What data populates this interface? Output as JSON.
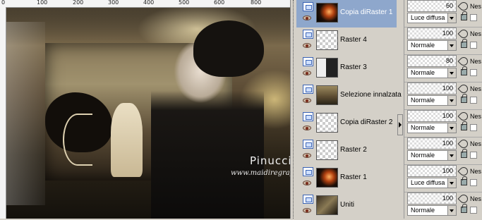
{
  "ruler": {
    "labels": [
      "0",
      "100",
      "200",
      "300",
      "400",
      "500",
      "600",
      "800"
    ]
  },
  "watermark": {
    "title": "Pinuccia",
    "url": "www.maidiregrafica.it"
  },
  "layers": [
    {
      "name": "Copia diRaster 1",
      "selected": true,
      "thumb": "dark"
    },
    {
      "name": "Raster 4",
      "selected": false,
      "thumb": "transparent"
    },
    {
      "name": "Raster 3",
      "selected": false,
      "thumb": "portrait"
    },
    {
      "name": "Selezione innalzata",
      "selected": false,
      "thumb": "scene"
    },
    {
      "name": "Copia diRaster 2",
      "selected": false,
      "thumb": "transparent"
    },
    {
      "name": "Raster 2",
      "selected": false,
      "thumb": "transparent"
    },
    {
      "name": "Raster 1",
      "selected": false,
      "thumb": "dark"
    },
    {
      "name": "Uniti",
      "selected": false,
      "thumb": "merged"
    }
  ],
  "properties": [
    {
      "opacity": "60",
      "blend": "Luce diffusa",
      "extra": "Nes"
    },
    {
      "opacity": "100",
      "blend": "Normale",
      "extra": "Nes"
    },
    {
      "opacity": "80",
      "blend": "Normale",
      "extra": "Nes"
    },
    {
      "opacity": "100",
      "blend": "Normale",
      "extra": "Nes"
    },
    {
      "opacity": "100",
      "blend": "Normale",
      "extra": "Nes"
    },
    {
      "opacity": "100",
      "blend": "Normale",
      "extra": "Nes"
    },
    {
      "opacity": "100",
      "blend": "Luce diffusa",
      "extra": "Nes"
    },
    {
      "opacity": "100",
      "blend": "Normale",
      "extra": "Nes"
    }
  ],
  "colors": {
    "selection": "#8ea7cc",
    "panel": "#d4d0c8"
  }
}
